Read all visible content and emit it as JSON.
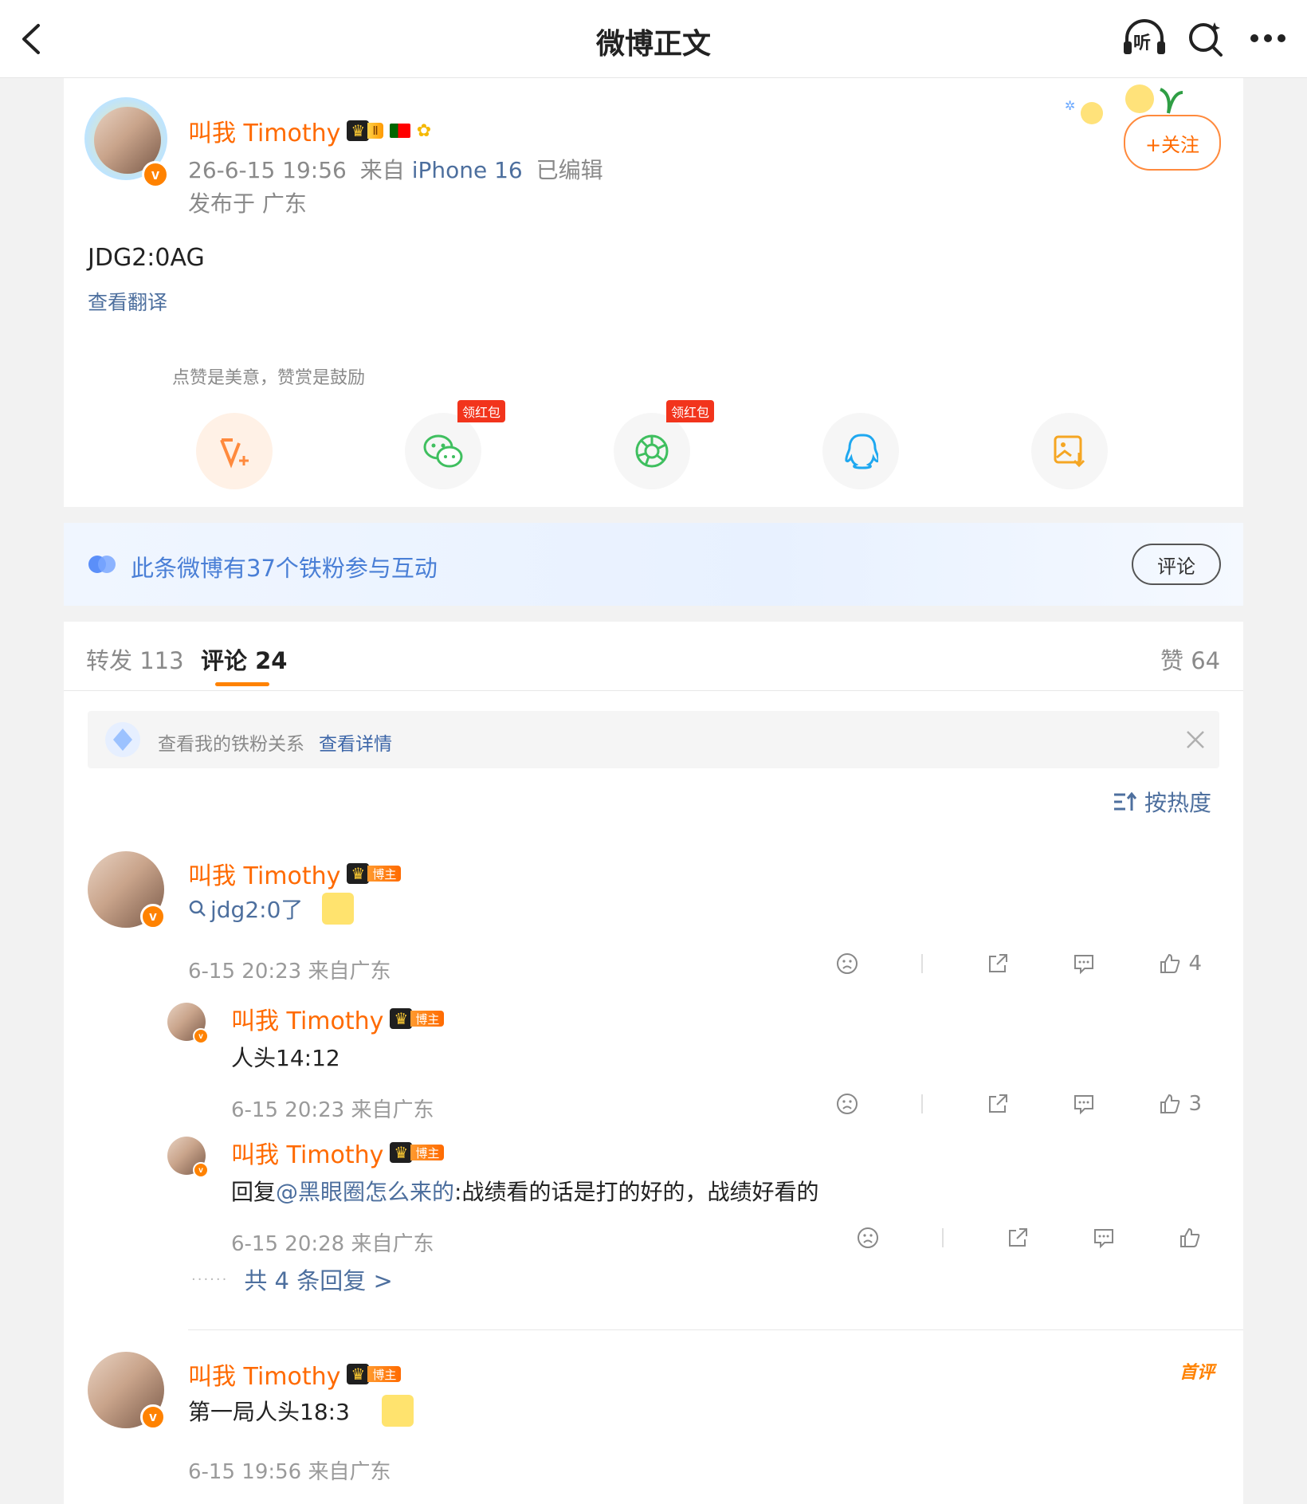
{
  "nav": {
    "title": "微博正文",
    "listen_label": "听"
  },
  "post": {
    "author": "叫我 Timothy",
    "level_badge": "Ⅱ",
    "time": "26-6-15 19:56",
    "source_prefix": "来自",
    "device": "iPhone 16",
    "edited": "已编辑",
    "location": "发布于 广东",
    "content": "JDG2:0AG",
    "translate": "查看翻译",
    "follow_label": "+关注",
    "v_badge": "v"
  },
  "reward_tip": "点赞是美意，赞赏是鼓励",
  "share": {
    "red_packet_label": "领红包",
    "buttons": [
      {
        "name": "reward-icon",
        "color": "#ff8a3d"
      },
      {
        "name": "wechat-icon",
        "color": "#3fbf5f"
      },
      {
        "name": "moments-icon",
        "color": "#3fbf5f"
      },
      {
        "name": "qq-icon",
        "color": "#1fa8f0"
      },
      {
        "name": "save-image-icon",
        "color": "#f5a623"
      }
    ]
  },
  "fans_banner": {
    "text": "此条微博有37个铁粉参与互动",
    "button": "评论"
  },
  "tabs": {
    "repost": "转发 113",
    "comments": "评论 24",
    "likes": "赞 64"
  },
  "fans_notice": {
    "text": "查看我的铁粉关系",
    "link": "查看详情"
  },
  "sort_label": "按热度",
  "comments": [
    {
      "author": "叫我 Timothy",
      "badge": "博主",
      "text": "jdg2:0了",
      "meta": "6-15 20:23 来自广东",
      "likes": "4",
      "replies": [
        {
          "author": "叫我 Timothy",
          "badge": "博主",
          "text": "人头14:12",
          "meta": "6-15 20:23 来自广东",
          "likes": "3"
        },
        {
          "author": "叫我 Timothy",
          "badge": "博主",
          "reply_prefix": "回复",
          "mention": "@黑眼圈怎么来的",
          "text": ":战绩看的话是打的好的，战绩好看的",
          "meta": "6-15 20:28 来自广东",
          "likes": ""
        }
      ],
      "more_replies": "共 4 条回复 >"
    },
    {
      "author": "叫我 Timothy",
      "badge": "博主",
      "first_tag": "首评",
      "text": "第一局人头18:3",
      "meta": "6-15 19:56 来自广东"
    }
  ]
}
